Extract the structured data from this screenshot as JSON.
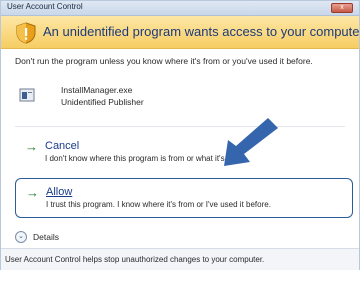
{
  "window": {
    "title": "User Account Control",
    "close_glyph": "x"
  },
  "banner": {
    "icon": "shield-warning-icon",
    "text": "An unidentified program wants access to your computer"
  },
  "warning": {
    "text": "Don't run the program unless you know where it's from or you've used it before."
  },
  "program": {
    "icon": "program-file-icon",
    "name": "InstallManager.exe",
    "publisher": "Unidentified Publisher"
  },
  "options": {
    "cancel": {
      "title": "Cancel",
      "description": "I don't know where this program is from or what it's for."
    },
    "allow": {
      "title": "Allow",
      "description": "I trust this program. I know where it's from or I've used it before."
    }
  },
  "details": {
    "label": "Details"
  },
  "footer": {
    "text": "User Account Control helps stop unauthorized changes to your computer."
  },
  "colors": {
    "banner_bg": "#f6cd63",
    "link_blue": "#1a3c8a",
    "arrow_green": "#1e7a2c",
    "pointer_blue": "#3566ad"
  }
}
